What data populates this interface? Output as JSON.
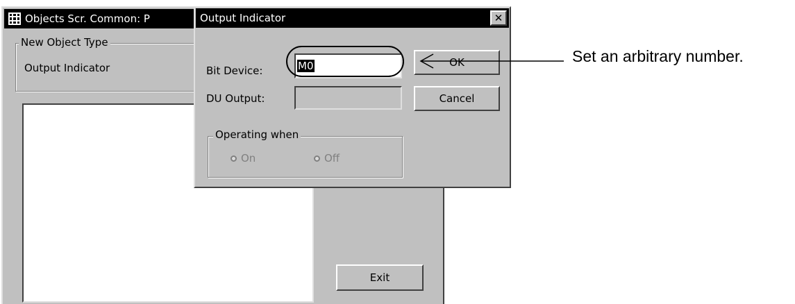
{
  "background_window": {
    "title": "Objects Scr. Common: P",
    "new_object_type_label": "New Object Type",
    "new_object_type_value": "Output Indicator",
    "exit_label": "Exit"
  },
  "dialog": {
    "title": "Output Indicator",
    "close_icon": "close-icon",
    "bit_device_label": "Bit Device:",
    "bit_device_value": "M0",
    "du_output_label": "DU Output:",
    "du_output_value": "",
    "ok_label": "OK",
    "cancel_label": "Cancel",
    "operating_when_label": "Operating when",
    "radio_on_label": "On",
    "radio_off_label": "Off"
  },
  "annotation": {
    "text": "Set an arbitrary number."
  }
}
